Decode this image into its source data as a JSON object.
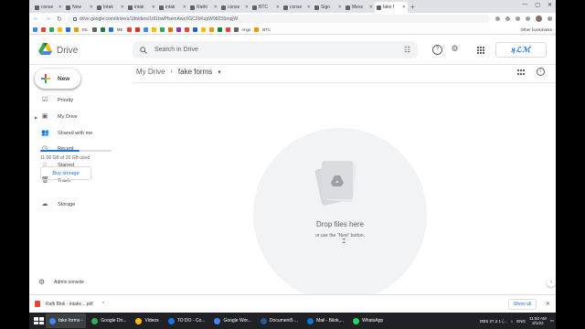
{
  "browser": {
    "tabs": [
      {
        "label": "conse"
      },
      {
        "label": "New"
      },
      {
        "label": "Intak"
      },
      {
        "label": "intak"
      },
      {
        "label": "intak"
      },
      {
        "label": "Rathi"
      },
      {
        "label": "conse"
      },
      {
        "label": "BTC"
      },
      {
        "label": "conse"
      },
      {
        "label": "Sign"
      },
      {
        "label": "Mess"
      },
      {
        "label": "fake f",
        "active": true
      }
    ],
    "url": "drive.google.com/drive/u/1/folders/1t91bwPfsemAwzXGC2bKupW9823SmpjW",
    "bookmarks": [
      {
        "label": "",
        "color": "#4285f4"
      },
      {
        "label": "",
        "color": "#ea4335"
      },
      {
        "label": "",
        "color": "#34a853"
      },
      {
        "label": "",
        "color": "#fbbc04"
      },
      {
        "label": "",
        "color": "#1a73e8"
      },
      {
        "label": "EIL",
        "color": "#f29900"
      },
      {
        "label": "",
        "color": "#5f6368"
      },
      {
        "label": "",
        "color": "#188038"
      },
      {
        "label": "ME",
        "color": "#1a73e8"
      },
      {
        "label": "",
        "color": "#ea4335"
      },
      {
        "label": "",
        "color": "#d93025"
      },
      {
        "label": "",
        "color": "#4285f4"
      },
      {
        "label": "",
        "color": "#fbbc04"
      },
      {
        "label": "",
        "color": "#34a853"
      },
      {
        "label": "",
        "color": "#e37400"
      },
      {
        "label": "",
        "color": "#8430ce"
      },
      {
        "label": "",
        "color": "#ea4335"
      },
      {
        "label": "",
        "color": "#1967d2"
      },
      {
        "label": "",
        "color": "#fbbc04"
      },
      {
        "label": "",
        "color": "#f29900"
      },
      {
        "label": "",
        "color": "#188038"
      },
      {
        "label": "",
        "color": "#ea4335"
      },
      {
        "label": "rings",
        "color": "#5f6368"
      },
      {
        "label": "BTC",
        "color": "#f29900"
      }
    ],
    "other_bookmarks": "Other bookmarks"
  },
  "header": {
    "app_name": "Drive",
    "search_placeholder": "Search in Drive",
    "help_icon": "?",
    "settings_icon": "⚙",
    "org_logo_text": "ʞℒℳ"
  },
  "sidebar": {
    "new_label": "New",
    "items": [
      {
        "label": "Priority",
        "icon": "☑"
      },
      {
        "label": "My Drive",
        "icon": "▣"
      },
      {
        "label": "Shared with me",
        "icon": "👥"
      },
      {
        "label": "Recent",
        "icon": "◷"
      },
      {
        "label": "Starred",
        "icon": "☆"
      },
      {
        "label": "Trash",
        "icon": "🗑"
      }
    ],
    "storage_label": "Storage",
    "storage_used": "11.06 GB of 20 GB used",
    "storage_fraction": 0.553,
    "buy_storage": "Buy storage",
    "admin_console": "Admin console"
  },
  "main": {
    "breadcrumb_root": "My Drive",
    "breadcrumb_current": "fake forms",
    "drop_title": "Drop files here",
    "drop_subtitle": "or use the \"New\" button."
  },
  "downloads": {
    "file_name": "Rafti Blok - intake....pdf",
    "show_all": "Show all"
  },
  "taskbar": {
    "items": [
      {
        "label": "fake forms -",
        "color": "#4285f4",
        "active": true
      },
      {
        "label": "Google Dri...",
        "color": "#34a853"
      },
      {
        "label": "Videos",
        "color": "#fbbc04"
      },
      {
        "label": "TO DO - Co...",
        "color": "#1a73e8"
      },
      {
        "label": "Google Wor...",
        "color": "#4285f4"
      },
      {
        "label": "Document5 ...",
        "color": "#2b579a"
      },
      {
        "label": "Mail - Bilok,...",
        "color": "#0078d4"
      },
      {
        "label": "WhatsApp",
        "color": "#25d366"
      }
    ],
    "tray_item": "OBS 27.2.1 (...",
    "language": "ENG",
    "time": "11:52 AM",
    "date": "3/1/22"
  }
}
